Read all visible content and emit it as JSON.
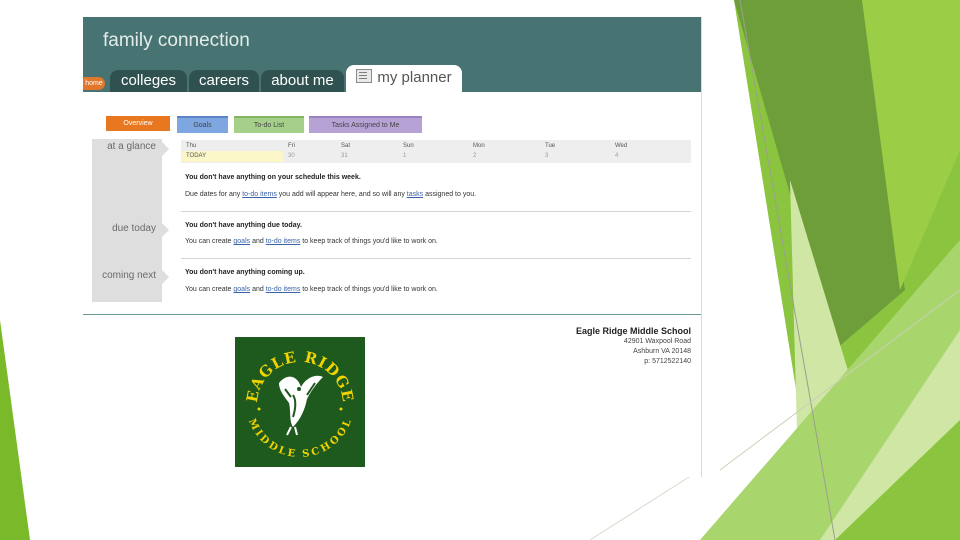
{
  "header": {
    "brand": "family connection",
    "home_label": "home"
  },
  "nav": {
    "tabs": [
      {
        "label": "colleges"
      },
      {
        "label": "careers"
      },
      {
        "label": "about me"
      },
      {
        "label": "my planner",
        "active": true,
        "icon": "planner-icon"
      }
    ]
  },
  "subtabs": [
    {
      "label": "Overview",
      "color": "#e8771f",
      "active": true
    },
    {
      "label": "Goals",
      "color": "#7ea6e0"
    },
    {
      "label": "To-do List",
      "color": "#a6d08a"
    },
    {
      "label": "Tasks Assigned to Me",
      "color": "#b7a2d6"
    }
  ],
  "sections": {
    "glance_label": "at a glance",
    "due_label": "due today",
    "next_label": "coming next"
  },
  "week": {
    "days": [
      {
        "name": "Thu",
        "num": "TODAY"
      },
      {
        "name": "Fri",
        "num": "30"
      },
      {
        "name": "Sat",
        "num": "31"
      },
      {
        "name": "Sun",
        "num": "1"
      },
      {
        "name": "Mon",
        "num": "2"
      },
      {
        "name": "Tue",
        "num": "3"
      },
      {
        "name": "Wed",
        "num": "4"
      }
    ]
  },
  "glance": {
    "empty": "You don't have anything on your schedule this week.",
    "hint_pre": "Due dates for any ",
    "hint_link1": "to-do items",
    "hint_mid": " you add will appear here, and so will any ",
    "hint_link2": "tasks",
    "hint_post": " assigned to you."
  },
  "due": {
    "empty": "You don't have anything due today.",
    "hint_pre": "You can create ",
    "hint_link1": "goals",
    "hint_mid": " and ",
    "hint_link2": "to-do items",
    "hint_post": " to keep track of things you'd like to work on."
  },
  "next": {
    "empty": "You don't have anything coming up.",
    "hint_pre": "You can create ",
    "hint_link1": "goals",
    "hint_mid": " and ",
    "hint_link2": "to-do items",
    "hint_post": " to keep track of things you'd like to work on."
  },
  "school": {
    "name": "Eagle Ridge Middle School",
    "address1": "42901 Waxpool Road",
    "address2": "Ashburn VA 20148",
    "phone": "p: 5712522140",
    "logo_top": "EAGLE RIDGE",
    "logo_bottom": "MIDDLE SCHOOL"
  },
  "colors": {
    "header": "#477472",
    "accent": "#e8771f",
    "slide_green": "#7ab929",
    "logo_green": "#1e5a1e",
    "logo_gold": "#f1d300"
  }
}
